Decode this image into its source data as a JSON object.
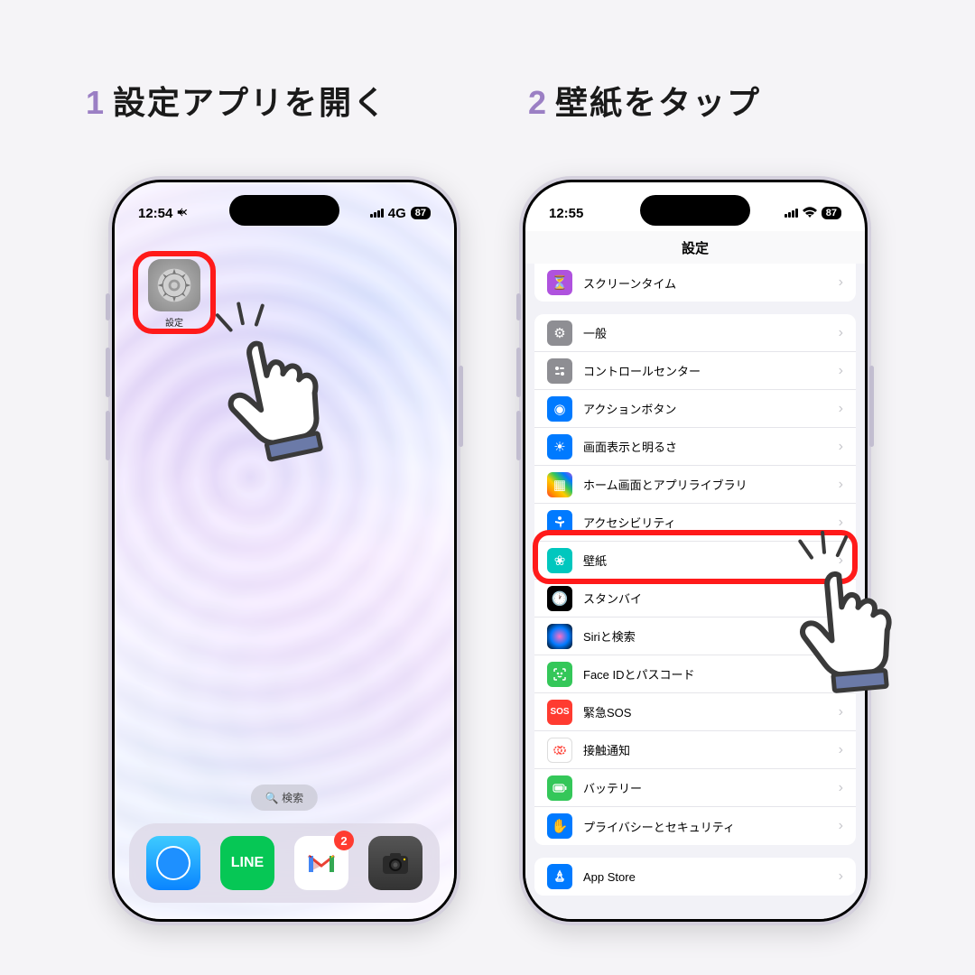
{
  "step1": {
    "num": "1",
    "title": "設定アプリを開く",
    "status": {
      "time": "12:54",
      "network": "4G",
      "battery": "87"
    },
    "appLabel": "設定",
    "searchLabel": "検索",
    "dock": {
      "lineText": "LINE",
      "gmailBadge": "2"
    }
  },
  "step2": {
    "num": "2",
    "title": "壁紙をタップ",
    "status": {
      "time": "12:55",
      "battery": "87"
    },
    "navTitle": "設定",
    "screenTimeRow": "スクリーンタイム",
    "rows": {
      "general": "一般",
      "controlCenter": "コントロールセンター",
      "actionButton": "アクションボタン",
      "display": "画面表示と明るさ",
      "homescreen": "ホーム画面とアプリライブラリ",
      "accessibility": "アクセシビリティ",
      "wallpaper": "壁紙",
      "standby": "スタンバイ",
      "siri": "Siriと検索",
      "faceid": "Face IDとパスコード",
      "sos": "緊急SOS",
      "sosIcon": "SOS",
      "exposure": "接触通知",
      "battery": "バッテリー",
      "privacy": "プライバシーとセキュリティ",
      "appstore": "App Store"
    }
  }
}
